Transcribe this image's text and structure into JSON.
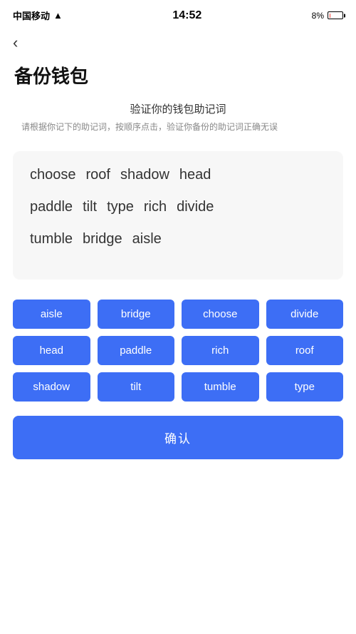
{
  "statusBar": {
    "carrier": "中国移动",
    "time": "14:52",
    "batteryPercent": "8%"
  },
  "back": "‹",
  "pageTitle": "备份钱包",
  "subtitleMain": "验证你的钱包助记词",
  "subtitleDesc": "请根据你记下的助记词，按顺序点击，验证你备份的助记词正确无误",
  "displayRows": [
    [
      "choose",
      "roof",
      "shadow",
      "head"
    ],
    [
      "paddle",
      "tilt",
      "type",
      "rich",
      "divide"
    ],
    [
      "tumble",
      "bridge",
      "aisle"
    ]
  ],
  "chips": [
    "aisle",
    "bridge",
    "choose",
    "divide",
    "head",
    "paddle",
    "rich",
    "roof",
    "shadow",
    "tilt",
    "tumble",
    "type"
  ],
  "confirmLabel": "确认"
}
